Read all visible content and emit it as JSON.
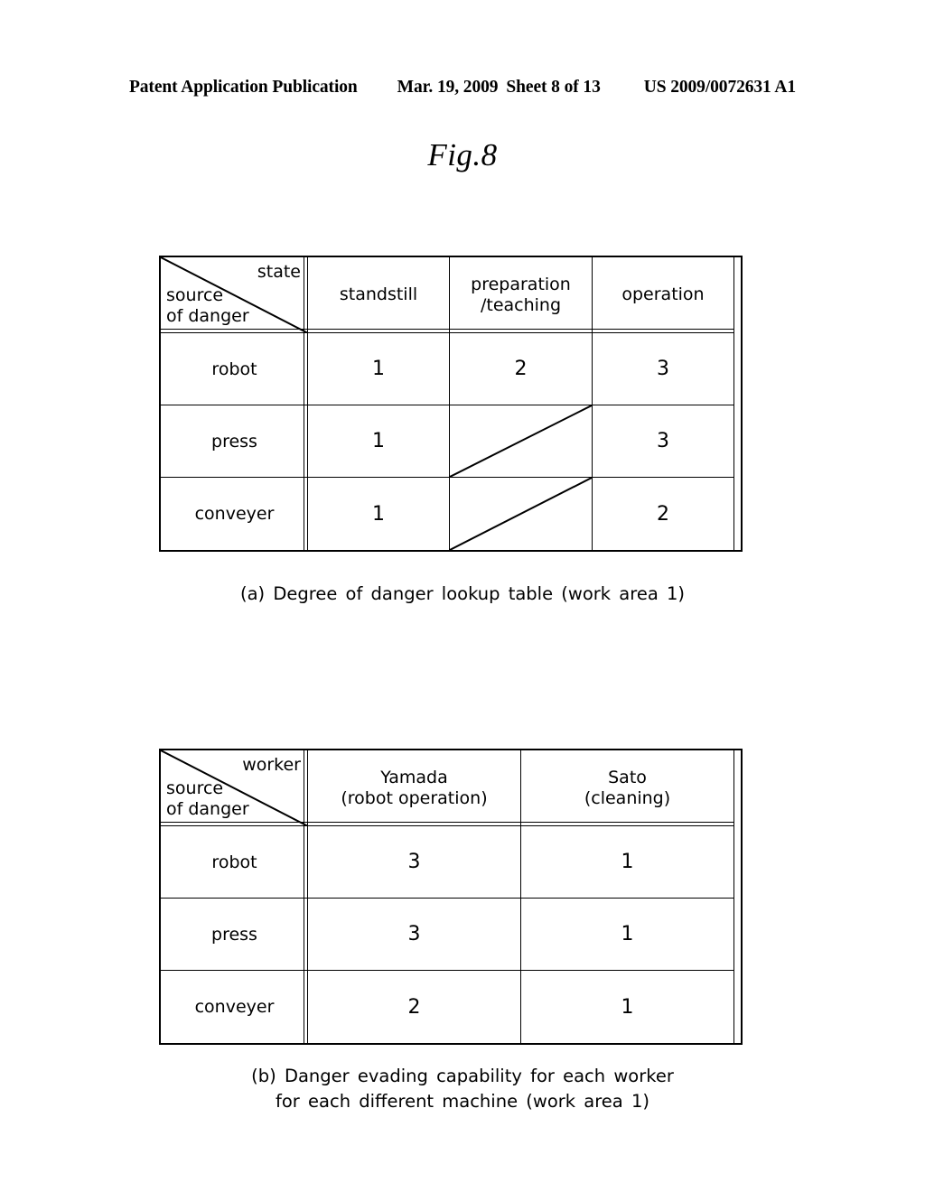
{
  "page_header": {
    "publication": "Patent Application Publication",
    "date": "Mar. 19, 2009",
    "sheet": "Sheet 8 of 13",
    "patent_number": "US 2009/0072631 A1"
  },
  "figure": {
    "title": "Fig.8"
  },
  "table_a": {
    "corner": {
      "column_axis": "state",
      "row_axis_line1": "source",
      "row_axis_line2": "of danger"
    },
    "columns": [
      {
        "label": "standstill"
      },
      {
        "label_line1": "preparation",
        "label_line2": "/teaching"
      },
      {
        "label": "operation"
      }
    ],
    "rows": [
      {
        "label": "robot",
        "values": [
          "1",
          "2",
          "3"
        ]
      },
      {
        "label": "press",
        "values": [
          "1",
          "",
          "3"
        ]
      },
      {
        "label": "conveyer",
        "values": [
          "1",
          "",
          "2"
        ]
      }
    ],
    "caption": "(a) Degree of danger lookup table (work area 1)"
  },
  "table_b": {
    "corner": {
      "column_axis": "worker",
      "row_axis_line1": "source",
      "row_axis_line2": "of danger"
    },
    "columns": [
      {
        "label_line1": "Yamada",
        "label_line2": "(robot operation)"
      },
      {
        "label_line1": "Sato",
        "label_line2": "(cleaning)"
      }
    ],
    "rows": [
      {
        "label": "robot",
        "values": [
          "3",
          "1"
        ]
      },
      {
        "label": "press",
        "values": [
          "3",
          "1"
        ]
      },
      {
        "label": "conveyer",
        "values": [
          "2",
          "1"
        ]
      }
    ],
    "caption_line1": "(b) Danger evading capability for each worker",
    "caption_line2": "for each different machine (work area 1)"
  },
  "colors": {
    "ink": "#000000",
    "paper": "#ffffff"
  }
}
